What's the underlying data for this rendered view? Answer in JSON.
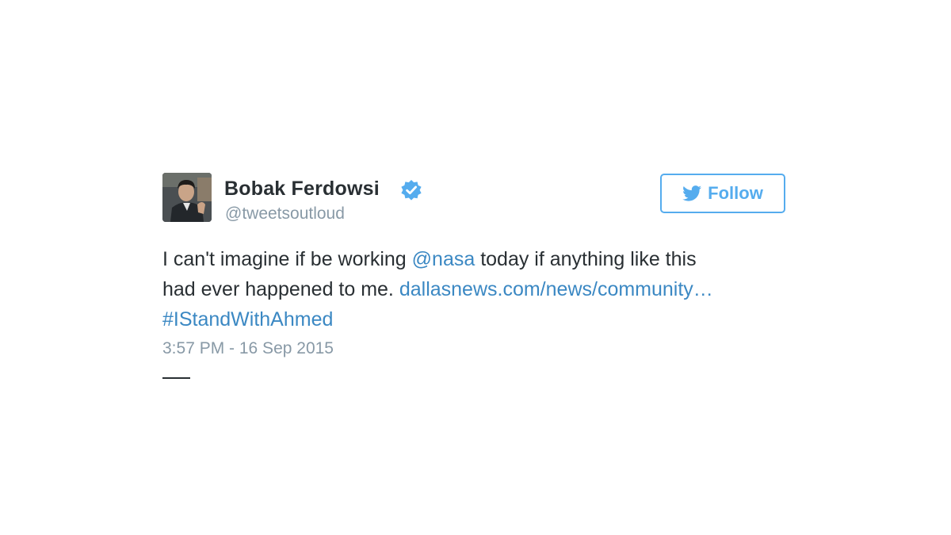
{
  "tweet": {
    "author": {
      "name": "Bobak Ferdowsi",
      "handle": "@tweetsoutloud",
      "verified": true
    },
    "follow_button": {
      "label": "Follow",
      "icon": "twitter-bird-icon"
    },
    "text": {
      "part1": "I can't imagine if be working ",
      "mention": "@nasa",
      "part2": " today if anything like this",
      "part3": "had ever happened to me. ",
      "url": "dallasnews.com/news/community…",
      "hashtag": "#IStandWithAhmed"
    },
    "timestamp": "3:57 PM - 16 Sep 2015"
  },
  "colors": {
    "link": "#3b88c3",
    "twitter_blue": "#55acee",
    "secondary_text": "#8899a6",
    "primary_text": "#292f33"
  }
}
